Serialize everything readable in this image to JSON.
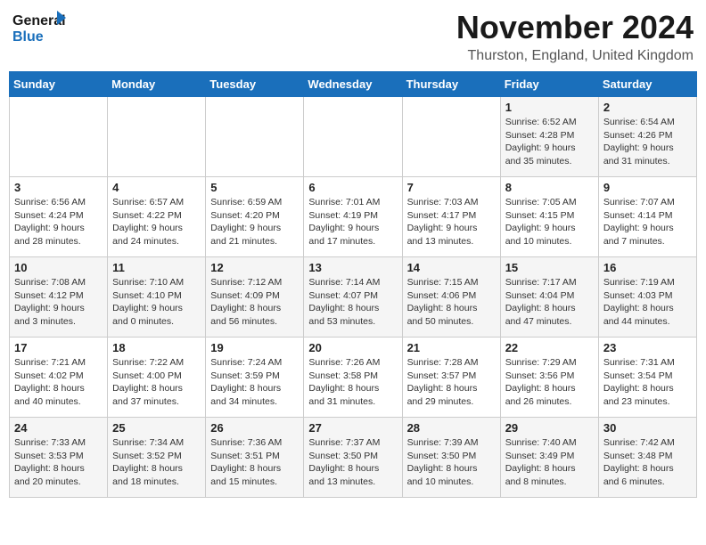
{
  "logo": {
    "line1": "General",
    "line2": "Blue"
  },
  "title": "November 2024",
  "location": "Thurston, England, United Kingdom",
  "days_of_week": [
    "Sunday",
    "Monday",
    "Tuesday",
    "Wednesday",
    "Thursday",
    "Friday",
    "Saturday"
  ],
  "weeks": [
    [
      {
        "day": "",
        "info": ""
      },
      {
        "day": "",
        "info": ""
      },
      {
        "day": "",
        "info": ""
      },
      {
        "day": "",
        "info": ""
      },
      {
        "day": "",
        "info": ""
      },
      {
        "day": "1",
        "info": "Sunrise: 6:52 AM\nSunset: 4:28 PM\nDaylight: 9 hours\nand 35 minutes."
      },
      {
        "day": "2",
        "info": "Sunrise: 6:54 AM\nSunset: 4:26 PM\nDaylight: 9 hours\nand 31 minutes."
      }
    ],
    [
      {
        "day": "3",
        "info": "Sunrise: 6:56 AM\nSunset: 4:24 PM\nDaylight: 9 hours\nand 28 minutes."
      },
      {
        "day": "4",
        "info": "Sunrise: 6:57 AM\nSunset: 4:22 PM\nDaylight: 9 hours\nand 24 minutes."
      },
      {
        "day": "5",
        "info": "Sunrise: 6:59 AM\nSunset: 4:20 PM\nDaylight: 9 hours\nand 21 minutes."
      },
      {
        "day": "6",
        "info": "Sunrise: 7:01 AM\nSunset: 4:19 PM\nDaylight: 9 hours\nand 17 minutes."
      },
      {
        "day": "7",
        "info": "Sunrise: 7:03 AM\nSunset: 4:17 PM\nDaylight: 9 hours\nand 13 minutes."
      },
      {
        "day": "8",
        "info": "Sunrise: 7:05 AM\nSunset: 4:15 PM\nDaylight: 9 hours\nand 10 minutes."
      },
      {
        "day": "9",
        "info": "Sunrise: 7:07 AM\nSunset: 4:14 PM\nDaylight: 9 hours\nand 7 minutes."
      }
    ],
    [
      {
        "day": "10",
        "info": "Sunrise: 7:08 AM\nSunset: 4:12 PM\nDaylight: 9 hours\nand 3 minutes."
      },
      {
        "day": "11",
        "info": "Sunrise: 7:10 AM\nSunset: 4:10 PM\nDaylight: 9 hours\nand 0 minutes."
      },
      {
        "day": "12",
        "info": "Sunrise: 7:12 AM\nSunset: 4:09 PM\nDaylight: 8 hours\nand 56 minutes."
      },
      {
        "day": "13",
        "info": "Sunrise: 7:14 AM\nSunset: 4:07 PM\nDaylight: 8 hours\nand 53 minutes."
      },
      {
        "day": "14",
        "info": "Sunrise: 7:15 AM\nSunset: 4:06 PM\nDaylight: 8 hours\nand 50 minutes."
      },
      {
        "day": "15",
        "info": "Sunrise: 7:17 AM\nSunset: 4:04 PM\nDaylight: 8 hours\nand 47 minutes."
      },
      {
        "day": "16",
        "info": "Sunrise: 7:19 AM\nSunset: 4:03 PM\nDaylight: 8 hours\nand 44 minutes."
      }
    ],
    [
      {
        "day": "17",
        "info": "Sunrise: 7:21 AM\nSunset: 4:02 PM\nDaylight: 8 hours\nand 40 minutes."
      },
      {
        "day": "18",
        "info": "Sunrise: 7:22 AM\nSunset: 4:00 PM\nDaylight: 8 hours\nand 37 minutes."
      },
      {
        "day": "19",
        "info": "Sunrise: 7:24 AM\nSunset: 3:59 PM\nDaylight: 8 hours\nand 34 minutes."
      },
      {
        "day": "20",
        "info": "Sunrise: 7:26 AM\nSunset: 3:58 PM\nDaylight: 8 hours\nand 31 minutes."
      },
      {
        "day": "21",
        "info": "Sunrise: 7:28 AM\nSunset: 3:57 PM\nDaylight: 8 hours\nand 29 minutes."
      },
      {
        "day": "22",
        "info": "Sunrise: 7:29 AM\nSunset: 3:56 PM\nDaylight: 8 hours\nand 26 minutes."
      },
      {
        "day": "23",
        "info": "Sunrise: 7:31 AM\nSunset: 3:54 PM\nDaylight: 8 hours\nand 23 minutes."
      }
    ],
    [
      {
        "day": "24",
        "info": "Sunrise: 7:33 AM\nSunset: 3:53 PM\nDaylight: 8 hours\nand 20 minutes."
      },
      {
        "day": "25",
        "info": "Sunrise: 7:34 AM\nSunset: 3:52 PM\nDaylight: 8 hours\nand 18 minutes."
      },
      {
        "day": "26",
        "info": "Sunrise: 7:36 AM\nSunset: 3:51 PM\nDaylight: 8 hours\nand 15 minutes."
      },
      {
        "day": "27",
        "info": "Sunrise: 7:37 AM\nSunset: 3:50 PM\nDaylight: 8 hours\nand 13 minutes."
      },
      {
        "day": "28",
        "info": "Sunrise: 7:39 AM\nSunset: 3:50 PM\nDaylight: 8 hours\nand 10 minutes."
      },
      {
        "day": "29",
        "info": "Sunrise: 7:40 AM\nSunset: 3:49 PM\nDaylight: 8 hours\nand 8 minutes."
      },
      {
        "day": "30",
        "info": "Sunrise: 7:42 AM\nSunset: 3:48 PM\nDaylight: 8 hours\nand 6 minutes."
      }
    ]
  ]
}
